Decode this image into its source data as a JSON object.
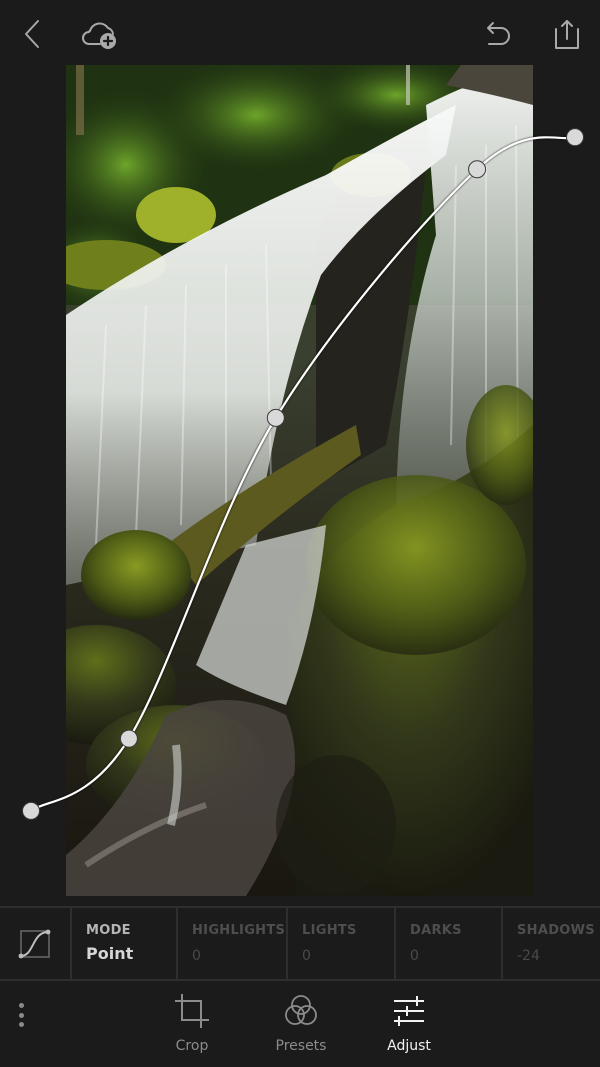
{
  "header": {
    "back_icon": "chevron-left-icon",
    "cloud_icon": "cloud-add-icon",
    "undo_icon": "undo-icon",
    "share_icon": "share-icon"
  },
  "photo": {
    "subject": "waterfall over mossy rocks in forest"
  },
  "tone_curve": {
    "mode": "Point",
    "points": [
      {
        "input": 0.0,
        "output": 0.07
      },
      {
        "input": 0.18,
        "output": 0.16
      },
      {
        "input": 0.45,
        "output": 0.56
      },
      {
        "input": 0.82,
        "output": 0.87
      },
      {
        "input": 1.0,
        "output": 0.91
      }
    ],
    "colors": {
      "line": "#ffffff",
      "handle": "#d9d9d9"
    }
  },
  "tone_panel": {
    "curve_icon": "tone-curve-icon",
    "mode": {
      "label": "MODE",
      "value": "Point"
    },
    "regions": [
      {
        "label": "HIGHLIGHTS",
        "value": "0"
      },
      {
        "label": "LIGHTS",
        "value": "0"
      },
      {
        "label": "DARKS",
        "value": "0"
      },
      {
        "label": "SHADOWS",
        "value": "-24"
      }
    ]
  },
  "bottom_bar": {
    "more_icon": "more-vertical-icon",
    "tabs": [
      {
        "label": "Crop",
        "icon": "crop-icon",
        "active": false
      },
      {
        "label": "Presets",
        "icon": "presets-icon",
        "active": false
      },
      {
        "label": "Adjust",
        "icon": "adjust-sliders-icon",
        "active": true
      }
    ]
  }
}
